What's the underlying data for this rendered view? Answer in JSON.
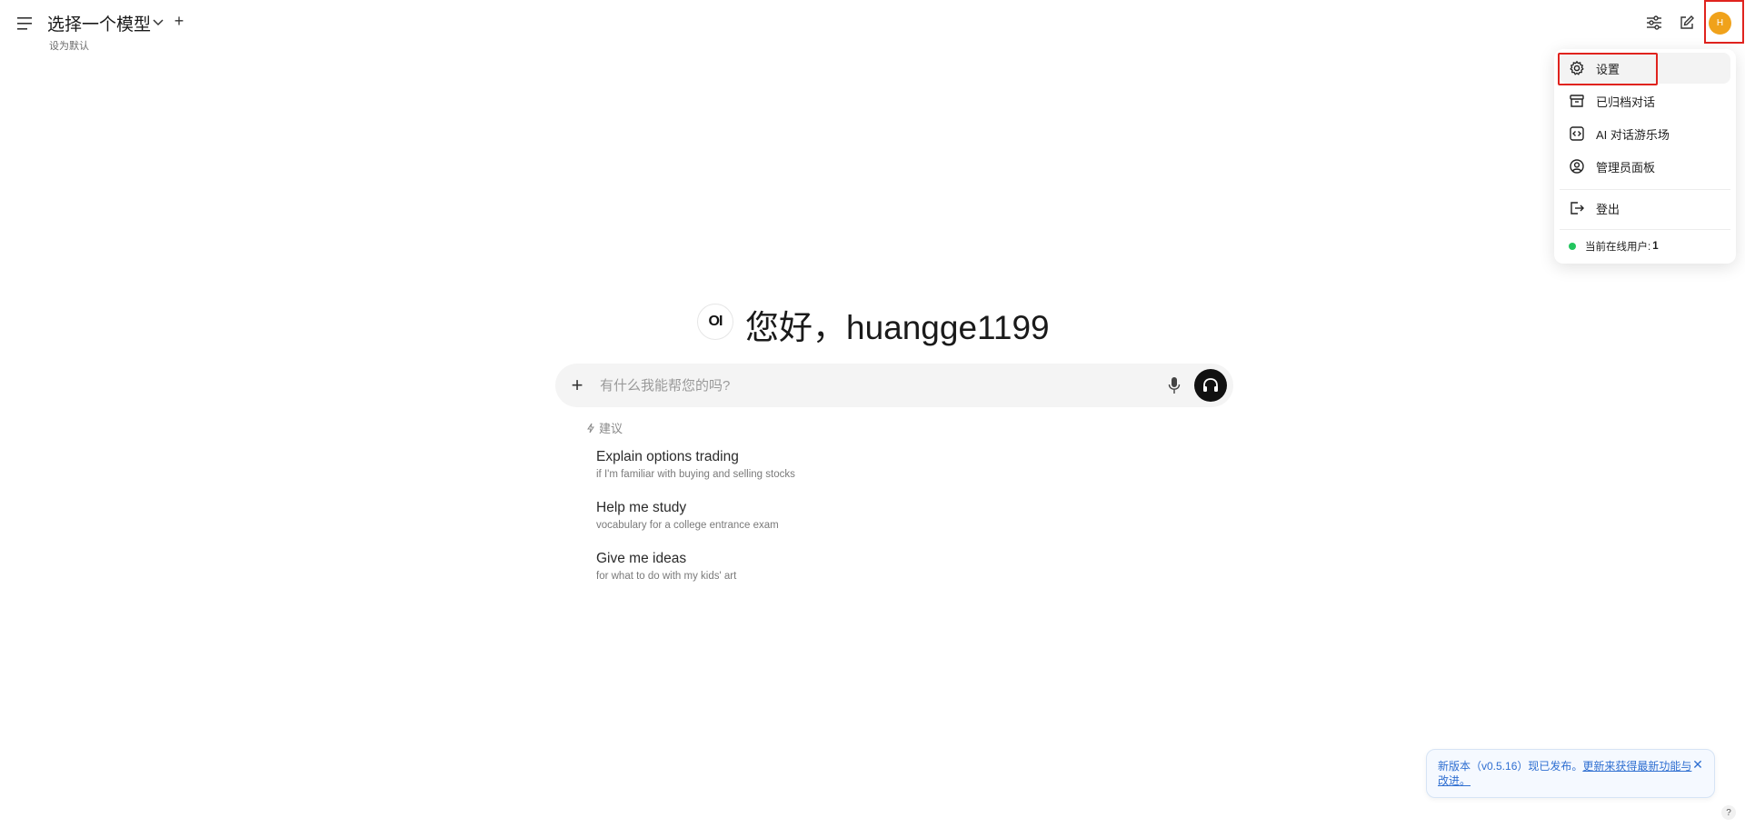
{
  "header": {
    "model_title": "选择一个模型",
    "add_symbol": "+",
    "set_default": "设为默认",
    "avatar_initial": "H"
  },
  "user_menu": {
    "items": [
      {
        "label": "设置",
        "icon": "gear-icon"
      },
      {
        "label": "已归档对话",
        "icon": "archive-icon"
      },
      {
        "label": "AI 对话游乐场",
        "icon": "code-icon"
      },
      {
        "label": "管理员面板",
        "icon": "user-circle-icon"
      },
      {
        "label": "登出",
        "icon": "logout-icon"
      }
    ],
    "online_label": "当前在线用户: ",
    "online_count": "1"
  },
  "main": {
    "logo_text": "OI",
    "greeting": "您好，huangge1199",
    "input_placeholder": "有什么我能帮您的吗?",
    "attach_symbol": "+",
    "suggestions_header": "建议",
    "suggestions": [
      {
        "title": "Explain options trading",
        "subtitle": "if I'm familiar with buying and selling stocks"
      },
      {
        "title": "Help me study",
        "subtitle": "vocabulary for a college entrance exam"
      },
      {
        "title": "Give me ideas",
        "subtitle": "for what to do with my kids' art"
      }
    ]
  },
  "toast": {
    "text": "新版本（v0.5.16）现已发布。",
    "link": "更新来获得最新功能与改进。",
    "close_symbol": "✕"
  },
  "help_symbol": "?",
  "colors": {
    "avatar": "#f0a21b",
    "highlight_box": "#e0231e",
    "online_dot": "#22c55e",
    "toast_text": "#2f6fd1"
  }
}
